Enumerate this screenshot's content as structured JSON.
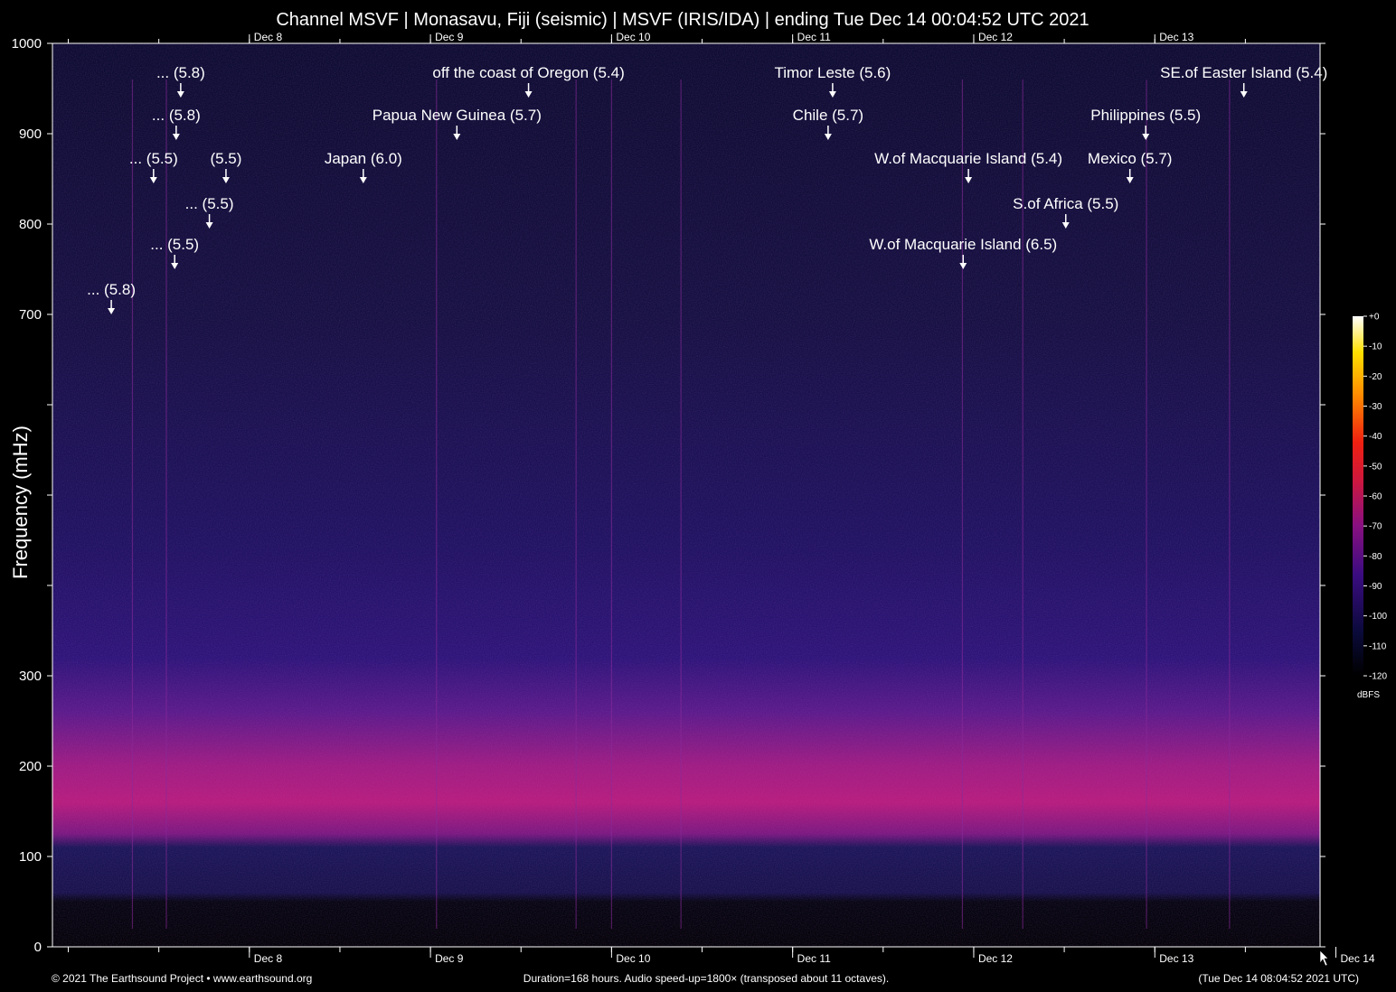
{
  "chart_data": {
    "type": "heatmap",
    "title": "Channel MSVF | Monasavu, Fiji (seismic) | MSVF (IRIS/IDA) | ending Tue Dec 14 00:04:52 UTC 2021",
    "ylabel": "Frequency (mHz)",
    "xlabel": "",
    "ylim": [
      0,
      1000
    ],
    "y_ticks": [
      0,
      100,
      200,
      300,
      400,
      500,
      600,
      700,
      800,
      900,
      1000
    ],
    "y_tick_labels": [
      "0",
      "100",
      "200",
      "300",
      "",
      "",
      "",
      "700",
      "800",
      "900",
      "1000"
    ],
    "x_unit": "hours",
    "x_range": [
      0,
      168
    ],
    "date_ticks": [
      {
        "label": "Dec  8",
        "hour": 26.1
      },
      {
        "label": "Dec  9",
        "hour": 50.1
      },
      {
        "label": "Dec 10",
        "hour": 74.1
      },
      {
        "label": "Dec 11",
        "hour": 98.1
      },
      {
        "label": "Dec 12",
        "hour": 122.1
      },
      {
        "label": "Dec 13",
        "hour": 146.1
      }
    ],
    "bottom_extra_tick": {
      "label": "Dec 14",
      "hour": 170.1
    },
    "colorbar": {
      "label": "dBFS",
      "ticks": [
        "+0",
        "-10",
        "-20",
        "-30",
        "-40",
        "-50",
        "-60",
        "-70",
        "-80",
        "-90",
        "-100",
        "-110",
        "-120"
      ],
      "range": [
        -120,
        0
      ]
    },
    "colors": {
      "background": "#000000",
      "low_noise": "#0a0a32",
      "mid_noise": "#2a1070",
      "band_peak": "#c01c78",
      "event_line": "#8a2a9a",
      "axis": "#ffffff"
    },
    "noise_band": {
      "center_mhz": 170,
      "description_values": [
        120,
        260
      ]
    },
    "annotations": [
      {
        "label": "... (5.8)",
        "hour": 7.8,
        "freq": 700
      },
      {
        "label": "... (5.5)",
        "hour": 16.2,
        "freq": 750
      },
      {
        "label": "... (5.5)",
        "hour": 20.8,
        "freq": 795
      },
      {
        "label": "... (5.5)",
        "hour": 13.4,
        "freq": 845
      },
      {
        "label": "(5.5)",
        "hour": 23.0,
        "freq": 845
      },
      {
        "label": "... (5.8)",
        "hour": 16.4,
        "freq": 893
      },
      {
        "label": "... (5.8)",
        "hour": 17.0,
        "freq": 940
      },
      {
        "label": "Japan (6.0)",
        "hour": 41.2,
        "freq": 845
      },
      {
        "label": "Papua New Guinea (5.7)",
        "hour": 53.6,
        "freq": 893
      },
      {
        "label": "off the coast of Oregon (5.4)",
        "hour": 63.1,
        "freq": 940
      },
      {
        "label": "Timor Leste (5.6)",
        "hour": 103.4,
        "freq": 940
      },
      {
        "label": "Chile (5.7)",
        "hour": 102.8,
        "freq": 893
      },
      {
        "label": "W.of Macquarie Island (5.4)",
        "hour": 121.4,
        "freq": 845
      },
      {
        "label": "W.of Macquarie Island (6.5)",
        "hour": 120.7,
        "freq": 750
      },
      {
        "label": "S.of Africa (5.5)",
        "hour": 134.3,
        "freq": 795
      },
      {
        "label": "Mexico (5.7)",
        "hour": 142.8,
        "freq": 845
      },
      {
        "label": "Philippines (5.5)",
        "hour": 144.9,
        "freq": 893
      },
      {
        "label": "SE.of Easter Island (5.4)",
        "hour": 157.9,
        "freq": 940
      }
    ],
    "event_lines_hours": [
      10.6,
      15.1,
      50.9,
      69.4,
      74.1,
      83.3,
      120.6,
      128.6,
      145.0,
      156.0
    ]
  },
  "footer": {
    "left": "© 2021 The Earthsound Project • www.earthsound.org",
    "center": "Duration=168 hours. Audio speed-up=1800× (transposed about 11 octaves).",
    "right": "(Tue Dec 14 08:04:52 2021 UTC)"
  }
}
